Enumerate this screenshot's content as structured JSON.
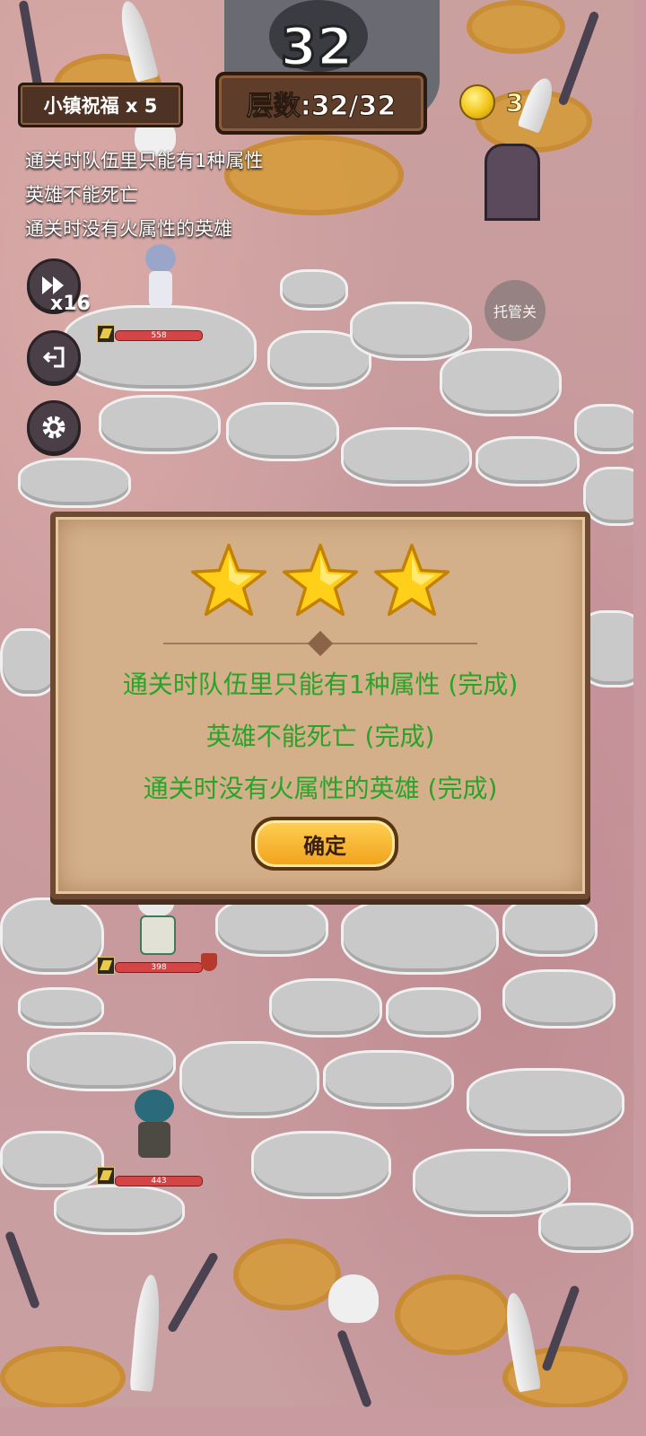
{
  "hud": {
    "floor_big": "32",
    "floor_label": "层数:32/32",
    "blessing": "小镇祝福 x 5",
    "coins": "3"
  },
  "objectives": [
    "通关时队伍里只能有1种属性",
    "英雄不能死亡",
    "通关时没有火属性的英雄"
  ],
  "controls": {
    "speed_label": "x16",
    "auto_label": "托管关"
  },
  "heroes": [
    {
      "hp": "558"
    },
    {
      "hp": "398"
    },
    {
      "hp": "443"
    }
  ],
  "dialog": {
    "stars": 3,
    "results": [
      "通关时队伍里只能有1种属性 (完成)",
      "英雄不能死亡 (完成)",
      "通关时没有火属性的英雄 (完成)"
    ],
    "confirm_label": "确定",
    "result_color": "#2aa32a"
  }
}
